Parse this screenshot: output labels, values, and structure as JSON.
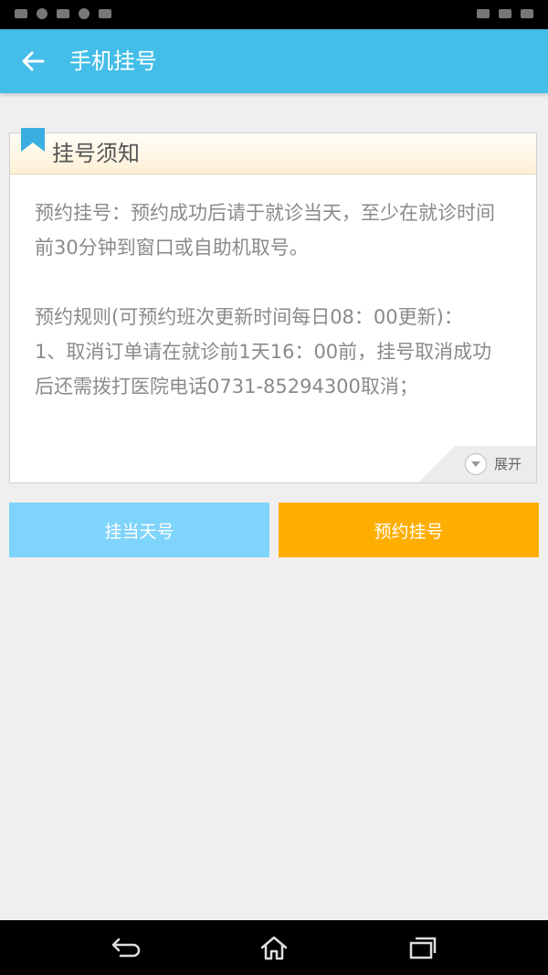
{
  "app": {
    "title": "手机挂号"
  },
  "notice": {
    "title": "挂号须知",
    "paragraph1": "预约挂号：预约成功后请于就诊当天，至少在就诊时间前30分钟到窗口或自助机取号。",
    "paragraph2": "预约规则(可预约班次更新时间每日08：00更新)：",
    "paragraph3": "1、取消订单请在就诊前1天16：00前，挂号取消成功后还需拨打医院电话0731-85294300取消；",
    "expand_label": "展开"
  },
  "actions": {
    "same_day": "挂当天号",
    "appointment": "预约挂号"
  },
  "colors": {
    "appbar": "#44bde8",
    "same_day_button": "#7fd4fb",
    "appointment_button": "#feae00",
    "bookmark": "#3aaee0"
  },
  "icons": {
    "back": "arrow-left",
    "bookmark": "bookmark",
    "expand": "chevron-down",
    "nav_back": "back-arrow",
    "nav_home": "home",
    "nav_recent": "recent-apps"
  }
}
